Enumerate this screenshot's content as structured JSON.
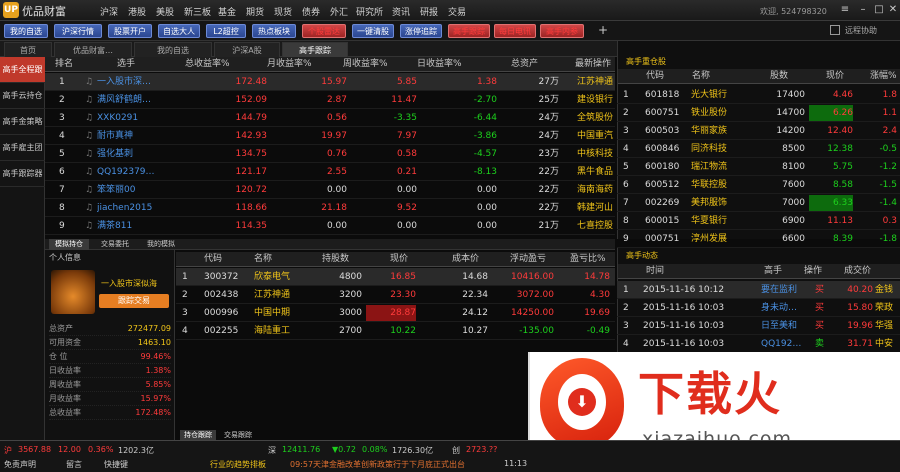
{
  "app": {
    "name": "优品财富",
    "logo": "UP"
  },
  "menu": [
    "沪深",
    "港股",
    "美股",
    "新三板",
    "基金",
    "期货",
    "现货",
    "债券",
    "外汇",
    "研究所",
    "资讯",
    "研报",
    "交易"
  ],
  "welcome": "欢迎,  524798320",
  "toolbar": {
    "buttons": [
      "我的自选",
      "沪深行情",
      "股票开户",
      "自选大人",
      "L2超控",
      "热点板块",
      "个股雷达",
      "一键清股",
      "涨停追踪",
      "高手跟踪",
      "每日电讯",
      "高手内参"
    ],
    "remote": "远程协助"
  },
  "tabs": [
    "首页",
    "优品财富…",
    "我的自选",
    "沪深A股",
    "高手跟踪"
  ],
  "sidebar": [
    "高手全程跟",
    "高手云持仓",
    "高手金策略",
    "高手雇主团",
    "高手跟踪器"
  ],
  "master": {
    "headers": [
      "排名",
      "选手",
      "总收益率%",
      "月收益率%",
      "周收益率%",
      "日收益率%",
      "总资产",
      "最新操作"
    ],
    "rows": [
      {
        "rank": "1",
        "name": "一入股市深…",
        "total": "172.48",
        "month": "15.97",
        "week": "5.85",
        "day": "1.38",
        "assets": "27万",
        "op": "江苏神通"
      },
      {
        "rank": "2",
        "name": "满风舒鹤朗…",
        "total": "152.09",
        "month": "2.87",
        "week": "11.47",
        "day": "-2.70",
        "assets": "25万",
        "op": "建设银行"
      },
      {
        "rank": "3",
        "name": "XXK0291",
        "total": "144.79",
        "month": "0.56",
        "week": "-3.35",
        "day": "-6.44",
        "assets": "24万",
        "op": "全筑股份"
      },
      {
        "rank": "4",
        "name": "耐市真神",
        "total": "142.93",
        "month": "19.97",
        "week": "7.97",
        "day": "-3.86",
        "assets": "24万",
        "op": "中国重汽"
      },
      {
        "rank": "5",
        "name": "强化基刺",
        "total": "134.75",
        "month": "0.76",
        "week": "0.58",
        "day": "-4.57",
        "assets": "23万",
        "op": "中核科技"
      },
      {
        "rank": "6",
        "name": "QQ192379…",
        "total": "121.17",
        "month": "2.55",
        "week": "0.21",
        "day": "-8.13",
        "assets": "22万",
        "op": "黑牛食品"
      },
      {
        "rank": "7",
        "name": "笨笨丽00",
        "total": "120.72",
        "month": "0.00",
        "week": "0.00",
        "day": "0.00",
        "assets": "22万",
        "op": "海南海药"
      },
      {
        "rank": "8",
        "name": "jiachen2015",
        "total": "118.66",
        "month": "21.18",
        "week": "9.52",
        "day": "0.00",
        "assets": "22万",
        "op": "韩建河山"
      },
      {
        "rank": "9",
        "name": "满茶811",
        "total": "114.35",
        "month": "0.00",
        "week": "0.00",
        "day": "0.00",
        "assets": "21万",
        "op": "七喜控股"
      }
    ]
  },
  "heavy": {
    "title": "高手重仓股",
    "headers": [
      "代码",
      "名称",
      "股数",
      "现价",
      "涨幅%"
    ],
    "rows": [
      {
        "n": "1",
        "code": "601818",
        "name": "光大银行",
        "shares": "17400",
        "price": "4.46",
        "pct": "1.8"
      },
      {
        "n": "2",
        "code": "600751",
        "name": "铁业股份",
        "shares": "14700",
        "price": "6.26",
        "pct": "1.1"
      },
      {
        "n": "3",
        "code": "600503",
        "name": "华丽家族",
        "shares": "14200",
        "price": "12.40",
        "pct": "2.4"
      },
      {
        "n": "4",
        "code": "600846",
        "name": "同济科技",
        "shares": "8500",
        "price": "12.38",
        "pct": "-0.5"
      },
      {
        "n": "5",
        "code": "600180",
        "name": "瑞江物流",
        "shares": "8100",
        "price": "5.75",
        "pct": "-1.2"
      },
      {
        "n": "6",
        "code": "600512",
        "name": "华联控股",
        "shares": "7600",
        "price": "8.58",
        "pct": "-1.5"
      },
      {
        "n": "7",
        "code": "002269",
        "name": "美邦服饰",
        "shares": "7000",
        "price": "6.33",
        "pct": "-1.4"
      },
      {
        "n": "8",
        "code": "600015",
        "name": "华夏银行",
        "shares": "6900",
        "price": "11.13",
        "pct": "0.3"
      },
      {
        "n": "9",
        "code": "000751",
        "name": "淳州发展",
        "shares": "6600",
        "price": "8.39",
        "pct": "-1.8"
      }
    ]
  },
  "dynamics": {
    "title": "高手动态",
    "headers": [
      "时间",
      "高手",
      "操作",
      "成交价"
    ],
    "rows": [
      {
        "n": "1",
        "time": "2015-11-16 10:12",
        "who": "要在监利",
        "op": "买",
        "price": "40.20",
        "stock": "金钱"
      },
      {
        "n": "2",
        "time": "2015-11-16 10:03",
        "who": "身未动…",
        "op": "买",
        "price": "15.80",
        "stock": "荣政"
      },
      {
        "n": "3",
        "time": "2015-11-16 10:03",
        "who": "日至美和",
        "op": "买",
        "price": "19.96",
        "stock": "华强"
      },
      {
        "n": "4",
        "time": "2015-11-16 10:03",
        "who": "QQ192…",
        "op": "卖",
        "price": "31.71",
        "stock": "中安"
      }
    ]
  },
  "subtabs": [
    "模拟持仓",
    "交易委托",
    "我的模拟"
  ],
  "person": {
    "title": "个人信息",
    "name": "一入股市深似海",
    "button": "跟踪交易",
    "stats": [
      {
        "label": "总资产",
        "value": "272477.09"
      },
      {
        "label": "可用资金",
        "value": "1463.10"
      },
      {
        "label": "仓  位",
        "value": "99.46%"
      },
      {
        "label": "日收益率",
        "value": "1.38%"
      },
      {
        "label": "周收益率",
        "value": "5.85%"
      },
      {
        "label": "月收益率",
        "value": "15.97%"
      },
      {
        "label": "总收益率",
        "value": "172.48%"
      }
    ]
  },
  "holdings": {
    "headers": [
      "代码",
      "名称",
      "持股数",
      "现价",
      "成本价",
      "浮动盈亏",
      "盈亏比%"
    ],
    "rows": [
      {
        "n": "1",
        "code": "300372",
        "name": "欣泰电气",
        "qty": "4800",
        "price": "16.85",
        "cost": "14.68",
        "pl": "10416.00",
        "plpct": "14.78"
      },
      {
        "n": "2",
        "code": "002438",
        "name": "江苏神通",
        "qty": "3200",
        "price": "23.30",
        "cost": "22.34",
        "pl": "3072.00",
        "plpct": "4.30"
      },
      {
        "n": "3",
        "code": "000996",
        "name": "中国中期",
        "qty": "3000",
        "price": "28.87",
        "cost": "24.12",
        "pl": "14250.00",
        "plpct": "19.69"
      },
      {
        "n": "4",
        "code": "002255",
        "name": "海陆重工",
        "qty": "2700",
        "price": "10.22",
        "cost": "10.27",
        "pl": "-135.00",
        "plpct": "-0.49"
      }
    ]
  },
  "bottomtabs": [
    "持仓跟踪",
    "交易跟踪"
  ],
  "status": {
    "sh": "沪",
    "sh_val": "3567.88",
    "sh_chg": "12.00",
    "sh_pct": "0.36%",
    "sh_amt": "1202.3亿",
    "sz": "深",
    "sz_val": "12411.76",
    "sz_chg": "▼0.72",
    "sz_pct": "0.08%",
    "sz_amt": "1726.30亿",
    "cy": "创",
    "cy_val": "2723.??",
    "items": [
      "免责声明",
      "留言",
      "快捷键"
    ],
    "ticker": "行业的趋势排板",
    "news": "09:57天津金融改革创新政策行于下月底正式出台",
    "time": "11:13"
  },
  "watermark": {
    "text": "下载火",
    "domain": "xiazaihuo.com"
  }
}
